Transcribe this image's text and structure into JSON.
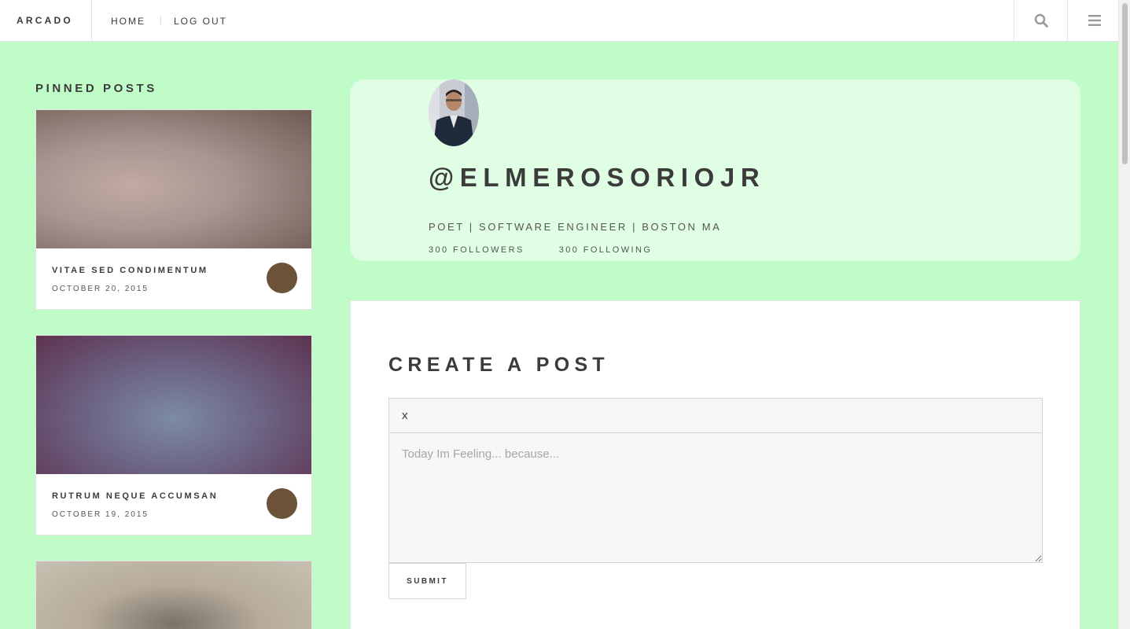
{
  "nav": {
    "logo": "ARCADO",
    "links": [
      "HOME",
      "LOG OUT"
    ],
    "search_icon": "search-icon",
    "menu_icon": "hamburger-menu-icon"
  },
  "pinned": {
    "title": "PINNED POSTS",
    "posts": [
      {
        "title": "VITAE SED CONDIMENTUM",
        "date": "OCTOBER 20, 2015",
        "image_colors": [
          "#b39e98",
          "#6c5450"
        ]
      },
      {
        "title": "RUTRUM NEQUE ACCUMSAN",
        "date": "OCTOBER 19, 2015",
        "image_colors": [
          "#7a88a0",
          "#5e3350"
        ]
      },
      {
        "title": "",
        "date": "",
        "image_colors": [
          "#c9bfb0",
          "#6e6860"
        ]
      }
    ]
  },
  "profile": {
    "handle": "@ELMEROSORIOJR",
    "bio": "POET | SOFTWARE ENGINEER | BOSTON MA",
    "followers": "300 FOLLOWERS",
    "following": "300 FOLLOWING"
  },
  "create_post": {
    "title": "CREATE A POST",
    "title_value": "x",
    "body_placeholder": "Today Im Feeling... because...",
    "submit_label": "SUBMIT"
  },
  "colors": {
    "page_bg": "#c0fcc8",
    "profile_bg": "#dffee4",
    "text": "#3c3b3b",
    "avatar_dot": "#6b5239"
  }
}
